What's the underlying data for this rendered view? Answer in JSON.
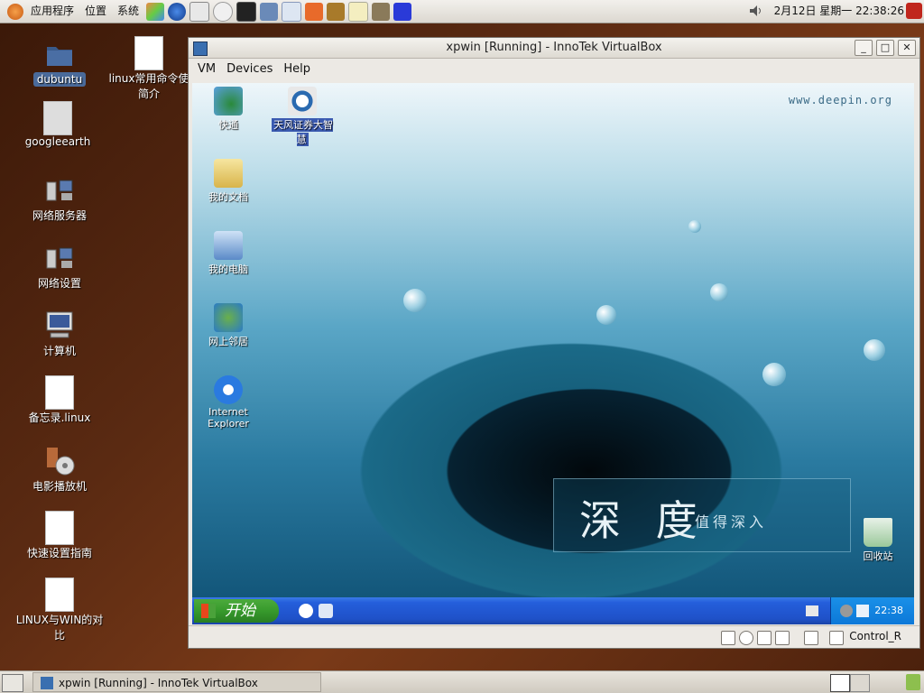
{
  "top_panel": {
    "menus": [
      "应用程序",
      "位置",
      "系统"
    ],
    "clock": "2月12日 星期一 22:38:26"
  },
  "desktop_icons": [
    {
      "label": "dubuntu",
      "icon": "folder-icon"
    },
    {
      "label": "googleearth",
      "icon": "googleearth-icon"
    },
    {
      "label": "网络服务器",
      "icon": "network-server-icon"
    },
    {
      "label": "网络设置",
      "icon": "network-settings-icon"
    },
    {
      "label": "计算机",
      "icon": "computer-icon"
    },
    {
      "label": "备忘录.linux",
      "icon": "document-icon"
    },
    {
      "label": "电影播放机",
      "icon": "movie-player-icon"
    },
    {
      "label": "快速设置指南",
      "icon": "document-icon"
    },
    {
      "label": "LINUX与WIN的对比",
      "icon": "document-icon"
    },
    {
      "label": "linux常用命令使简介",
      "icon": "document-icon"
    }
  ],
  "vbox_window": {
    "title": "xpwin [Running] - InnoTek VirtualBox",
    "menu": [
      "VM",
      "Devices",
      "Help"
    ],
    "status_key": "Control_R"
  },
  "guest": {
    "icons": [
      {
        "label": "快通",
        "icon": "shortcut-icon"
      },
      {
        "label": "天风证券大智慧",
        "icon": "stock-app-icon"
      },
      {
        "label": "我的文档",
        "icon": "my-documents-icon"
      },
      {
        "label": "我的电脑",
        "icon": "my-computer-icon"
      },
      {
        "label": "网上邻居",
        "icon": "network-places-icon"
      },
      {
        "label": "Internet Explorer",
        "icon": "ie-icon"
      },
      {
        "label": "回收站",
        "icon": "recycle-bin-icon"
      }
    ],
    "watermark_url": "www.deepin.org",
    "brand_big": "深 度",
    "brand_sub": "值得深入",
    "start_label": "开始",
    "tray_time": "22:38"
  },
  "bottom_panel": {
    "task_title": "xpwin [Running] - InnoTek VirtualBox"
  }
}
